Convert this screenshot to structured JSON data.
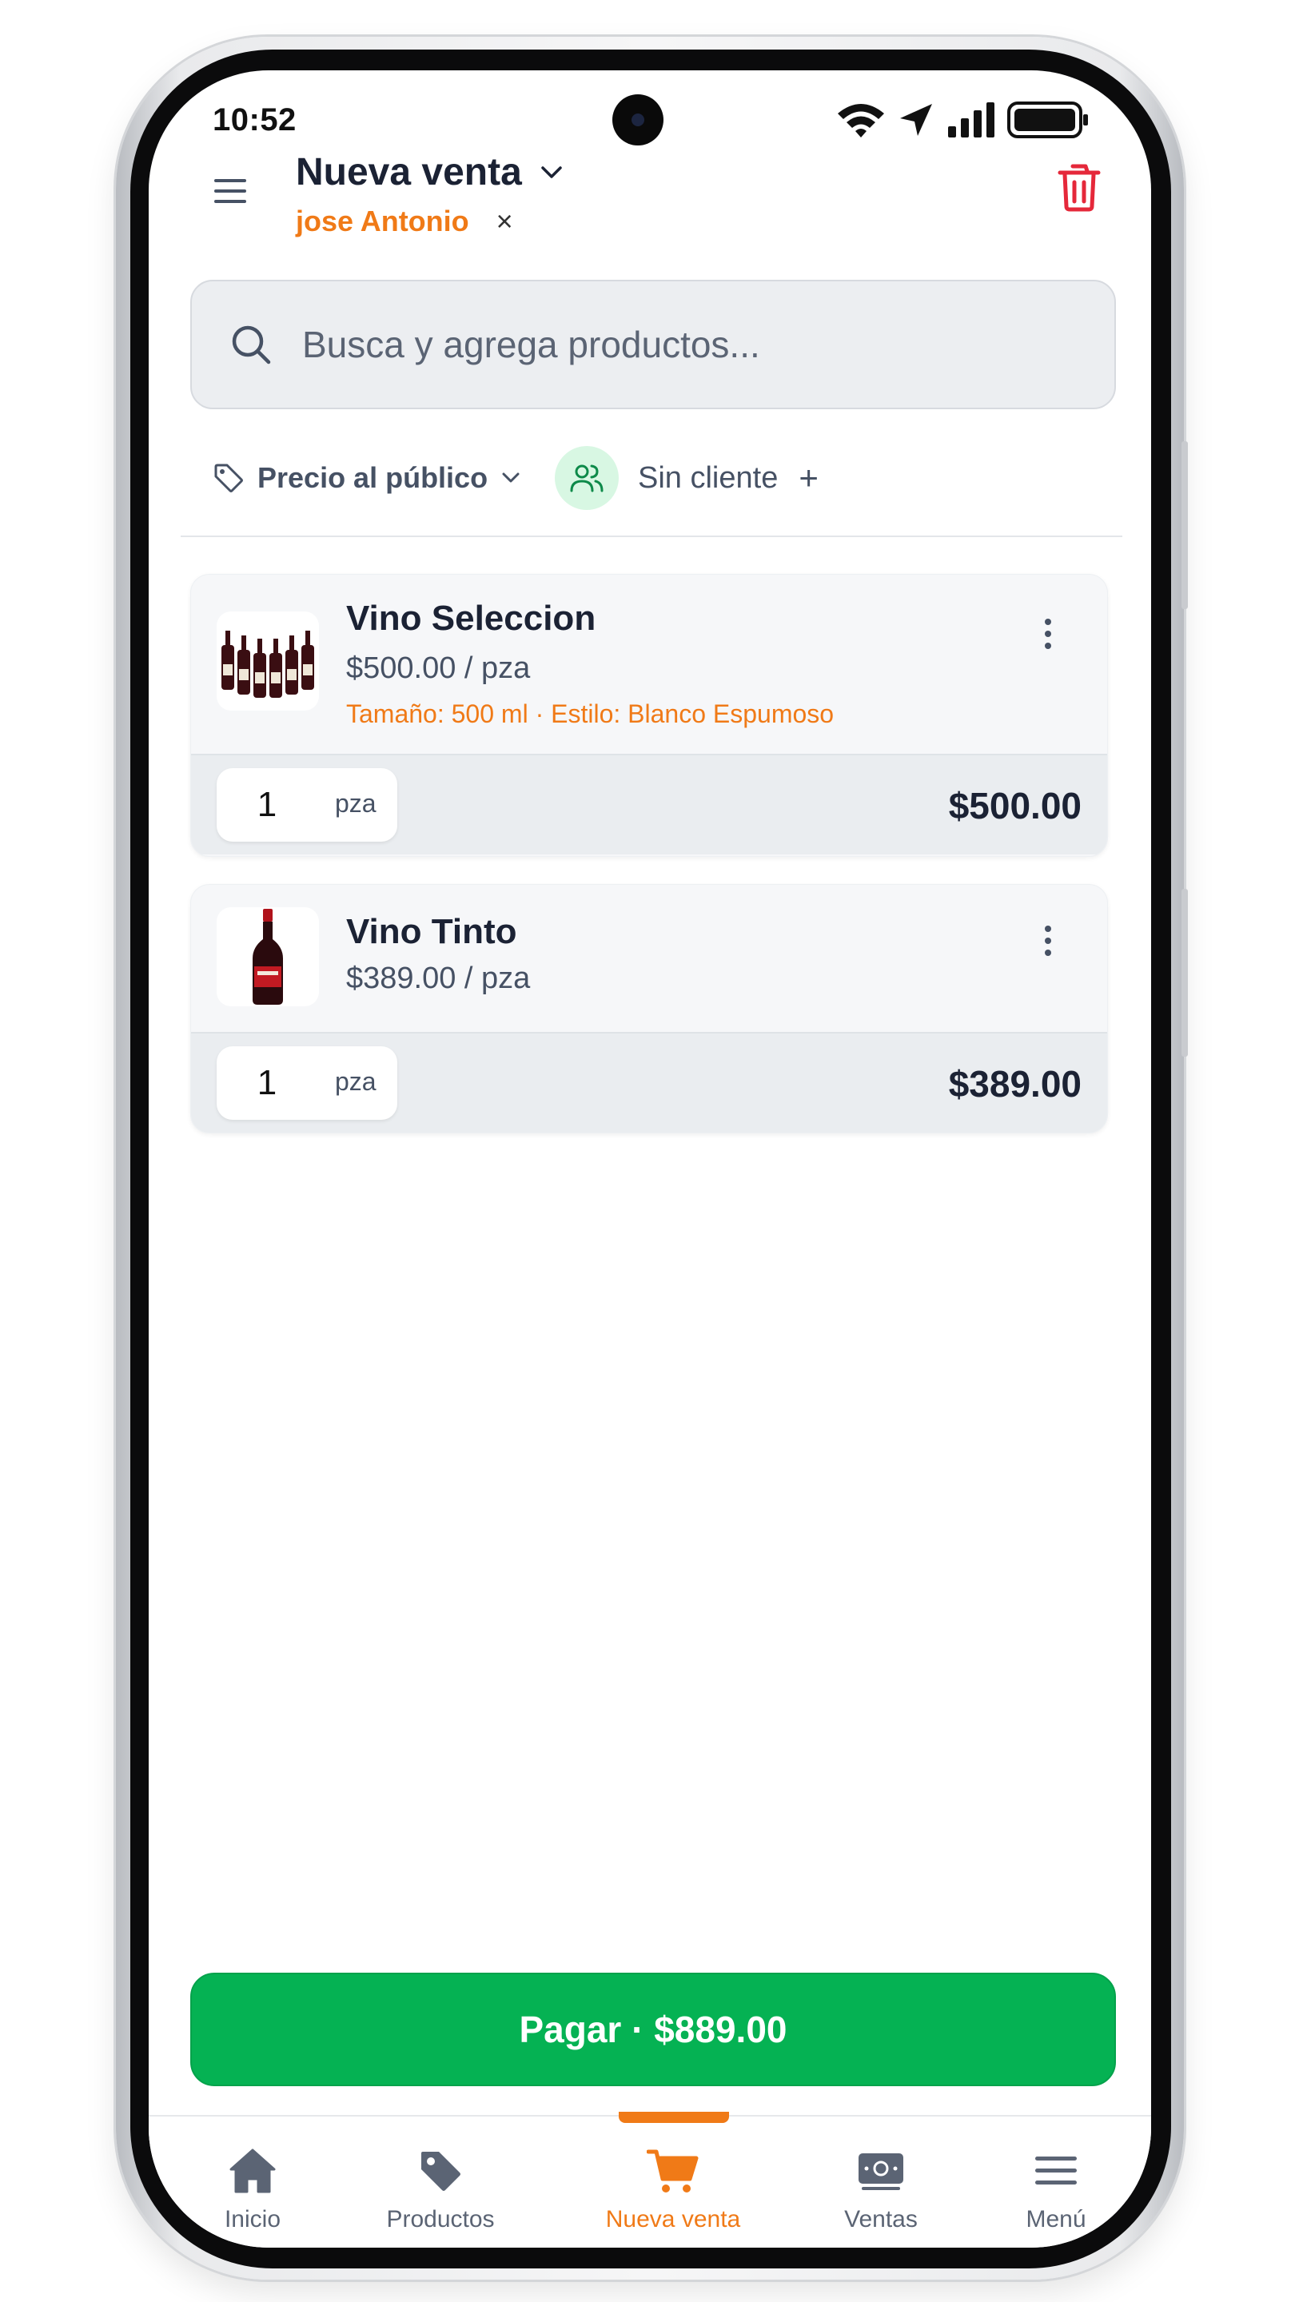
{
  "status_bar": {
    "time": "10:52"
  },
  "header": {
    "title": "Nueva venta",
    "seller": "jose Antonio",
    "seller_clear": "×"
  },
  "search": {
    "placeholder": "Busca y agrega productos..."
  },
  "filters": {
    "price_list": "Precio al público",
    "client": "Sin cliente",
    "client_add": "+"
  },
  "cart": {
    "items": [
      {
        "name": "Vino Seleccion",
        "unit_price": "$500.00 / pza",
        "variant": "Tamaño: 500 ml · Estilo: Blanco Espumoso",
        "quantity": "1",
        "unit": "pza",
        "total": "$500.00"
      },
      {
        "name": "Vino Tinto",
        "unit_price": "$389.00 / pza",
        "quantity": "1",
        "unit": "pza",
        "total": "$389.00"
      }
    ]
  },
  "pay_button": {
    "label": "Pagar · $889.00"
  },
  "bottom_nav": {
    "items": [
      {
        "label": "Inicio",
        "icon": "home-icon"
      },
      {
        "label": "Productos",
        "icon": "tag-icon"
      },
      {
        "label": "Nueva venta",
        "icon": "cart-icon",
        "active": true
      },
      {
        "label": "Ventas",
        "icon": "cash-icon"
      },
      {
        "label": "Menú",
        "icon": "menu-icon"
      }
    ]
  },
  "colors": {
    "accent": "#f07a17",
    "primary_text": "#1b2234",
    "pay_green": "#05b253",
    "danger": "#e5283a"
  }
}
